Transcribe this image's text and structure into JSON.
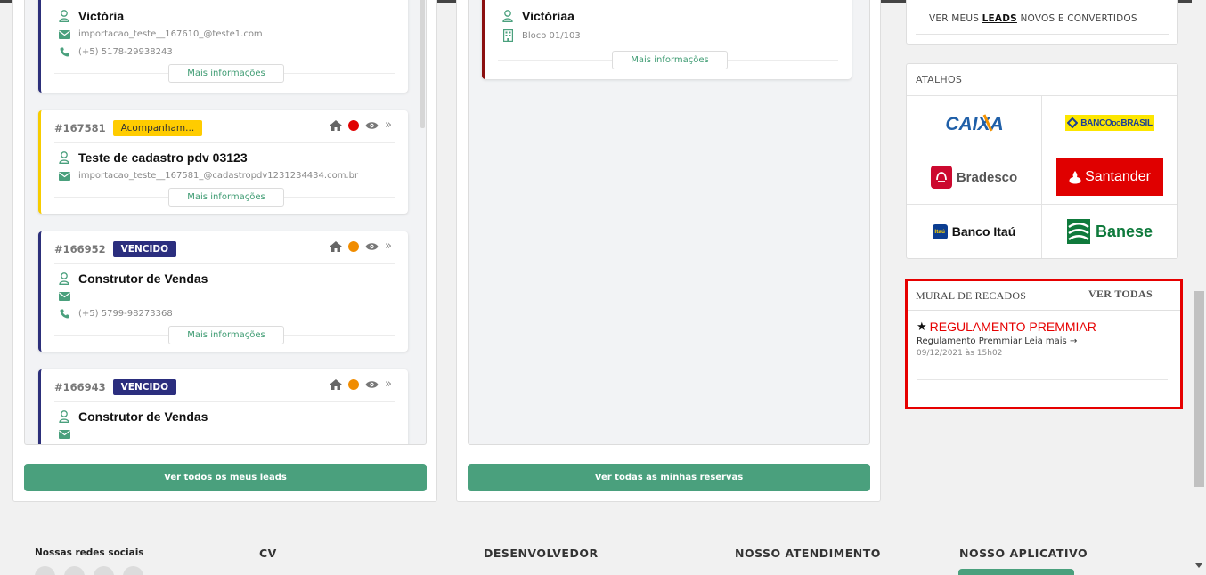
{
  "leads": {
    "cards": [
      {
        "name": "Victória",
        "email": "importacao_teste__167610_@teste1.com",
        "phone": "(+5) 5178-29938243",
        "more": "Mais informações"
      },
      {
        "id": "#167581",
        "badge": "Acompanham...",
        "name": "Teste de cadastro pdv 03123",
        "email": "importacao_teste__167581_@cadastropdv1231234434.com.br",
        "more": "Mais informações"
      },
      {
        "id": "#166952",
        "badge": "VENCIDO",
        "name": "Construtor de Vendas",
        "email": "",
        "phone": "(+5) 5799-98273368",
        "more": "Mais informações"
      },
      {
        "id": "#166943",
        "badge": "VENCIDO",
        "name": "Construtor de Vendas"
      }
    ],
    "button": "Ver todos os meus leads"
  },
  "reservas": {
    "cards": [
      {
        "name": "Victóriaa",
        "unit": "Bloco 01/103",
        "more": "Mais informações"
      }
    ],
    "button": "Ver todas as minhas reservas"
  },
  "sidebar": {
    "leads_link_prefix": "VER MEUS ",
    "leads_link_bold": "LEADS",
    "leads_link_suffix": " NOVOS E CONVERTIDOS",
    "atalhos_title": "ATALHOS",
    "banks": [
      "CAIXA",
      "BANCO DO BRASIL",
      "Bradesco",
      "Santander",
      "Banco Itaú",
      "Banese"
    ],
    "bank_bb_1": "BANCO",
    "bank_bb_2": "DO",
    "bank_bb_3": "BRASIL",
    "itau_badge": "Itaú"
  },
  "mural": {
    "title": "MURAL DE RECADOS",
    "ver_todas": "VER TODAS",
    "post_title": "REGULAMENTO PREMMIAR",
    "post_text": "Regulamento Premmiar Leia mais →",
    "post_date": "09/12/2021 às 15h02"
  },
  "footer": {
    "redes": "Nossas redes sociais",
    "cv": "CV",
    "dev": "DESENVOLVEDOR",
    "atendimento": "NOSSO ATENDIMENTO",
    "app": "NOSSO APLICATIVO"
  },
  "colors": {
    "accent_green": "#4aa07d",
    "badge_navy": "#2b2e7e",
    "badge_yellow": "#ffcc00",
    "highlight_red": "#e60000"
  }
}
